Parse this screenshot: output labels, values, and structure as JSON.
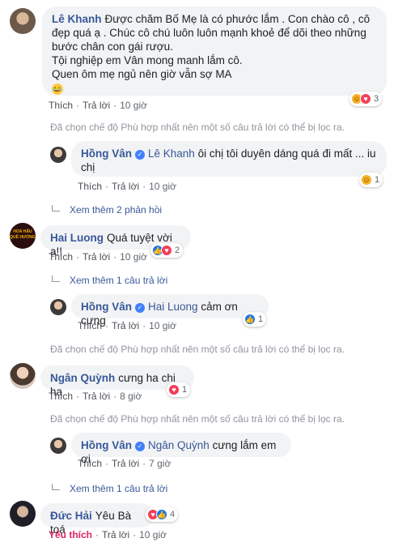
{
  "c1": {
    "author": "Lê Khanh",
    "lines": [
      "Được chăm Bố Mẹ là có phước lắm . Con chào cô , cô",
      "đẹp quá ạ . Chúc cô chú luôn luôn mạnh khoẻ để dõi theo những",
      "bước chân con gái rượu.",
      "Tội nghiệp em Vân mong manh lắm cô.",
      "Quen ôm mẹ ngủ nên giờ vẫn sợ MA"
    ],
    "emoji": "😂",
    "reaction_count": "3",
    "like": "Thích",
    "reply": "Trả lời",
    "time": "10 giờ"
  },
  "filter_note": "Đã chọn chế độ Phù hợp nhất nên một số câu trả lời có thể bị lọc ra.",
  "r1": {
    "author": "Hồng Vân",
    "mention": "Lê Khanh",
    "line1": "ôi chị tôi duyên dáng quá đi mất ... iu",
    "line2": "chị",
    "reaction_count": "1",
    "like": "Thích",
    "reply": "Trả lời",
    "time": "10 giờ"
  },
  "more1": "Xem thêm 2 phản hồi",
  "c2": {
    "author": "Hai Luong",
    "text": "Quá tuyệt vời ạ!!",
    "reaction_count": "2",
    "like": "Thích",
    "reply": "Trả lời",
    "time": "10 giờ",
    "avatar_text": "HOA HẬU QUÊ HƯƠNG"
  },
  "more2": "Xem thêm 1 câu trả lời",
  "r2": {
    "author": "Hồng Vân",
    "mention": "Hai Luong",
    "text": "cảm ơn cưng",
    "reaction_count": "1",
    "like": "Thích",
    "reply": "Trả lời",
    "time": "10 giờ"
  },
  "c3": {
    "author": "Ngân Quỳnh",
    "text": "cưng ha chi ha",
    "reaction_count": "1",
    "like": "Thích",
    "reply": "Trả lời",
    "time": "8 giờ"
  },
  "r3": {
    "author": "Hồng Vân",
    "mention": "Ngân Quỳnh",
    "text": "cưng lắm em ơi",
    "like": "Thích",
    "reply": "Trả lời",
    "time": "7 giờ"
  },
  "more3": "Xem thêm 1 câu trả lời",
  "c4": {
    "author": "Đức Hải",
    "text": "Yêu Bà toá",
    "reaction_count": "4",
    "like": "Yêu thích",
    "reply": "Trả lời",
    "time": "10 giờ"
  },
  "colors": {
    "name": "#385898",
    "bubble": "#f2f3f5",
    "meta": "#90949c",
    "love": "#f33e58",
    "like": "#1877f2",
    "liked_text": "#e0245e"
  }
}
